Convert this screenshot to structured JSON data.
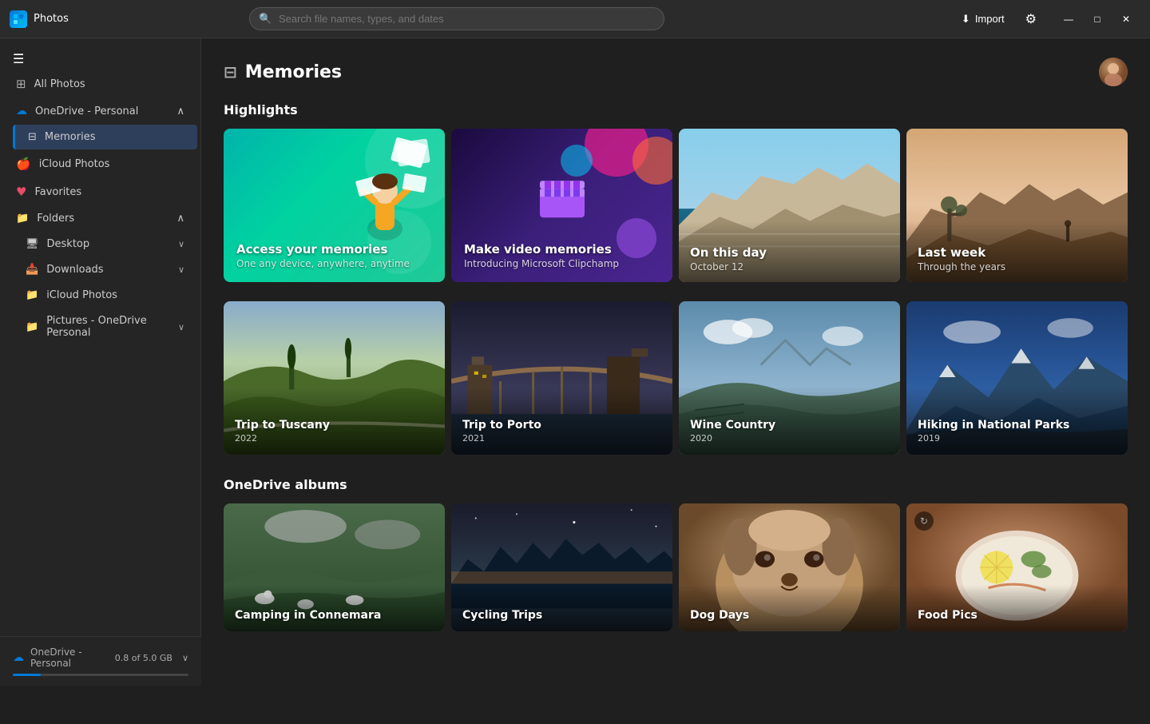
{
  "app": {
    "title": "Photos",
    "logo_icon": "🖼"
  },
  "titlebar": {
    "search_placeholder": "Search file names, types, and dates",
    "import_label": "Import",
    "import_icon": "⬇",
    "gear_icon": "⚙",
    "minimize": "—",
    "maximize": "□",
    "close": "✕"
  },
  "sidebar": {
    "hamburger_icon": "☰",
    "items": [
      {
        "id": "all-photos",
        "label": "All Photos",
        "icon": "🏠"
      },
      {
        "id": "onedrive-personal",
        "label": "OneDrive - Personal",
        "icon": "☁",
        "expandable": true,
        "expanded": true
      },
      {
        "id": "memories",
        "label": "Memories",
        "icon": "📋",
        "active": true,
        "subsection": true
      },
      {
        "id": "icloud-photos",
        "label": "iCloud Photos",
        "icon": "🍎"
      },
      {
        "id": "favorites",
        "label": "Favorites",
        "icon": "♥"
      },
      {
        "id": "folders",
        "label": "Folders",
        "icon": "📁",
        "expandable": true,
        "expanded": true
      },
      {
        "id": "desktop",
        "label": "Desktop",
        "icon": "🖥",
        "subsection": true,
        "expandable": true
      },
      {
        "id": "downloads",
        "label": "Downloads",
        "icon": "📥",
        "subsection": true,
        "expandable": true
      },
      {
        "id": "icloud-photos-folder",
        "label": "iCloud Photos",
        "icon": "📁",
        "subsection": true
      },
      {
        "id": "pictures",
        "label": "Pictures - OneDrive Personal",
        "icon": "📁",
        "subsection": true,
        "expandable": true
      }
    ],
    "footer": {
      "onedrive_label": "OneDrive - Personal",
      "storage": "0.8 of 5.0 GB",
      "chevron": "∨"
    }
  },
  "page": {
    "title": "Memories",
    "title_icon": "📋"
  },
  "highlights": {
    "section_title": "Highlights",
    "cards": [
      {
        "id": "access-memories",
        "title": "Access your memories",
        "subtitle": "One any device, anywhere, anytime",
        "type": "promo-green"
      },
      {
        "id": "make-video",
        "title": "Make video memories",
        "subtitle": "Introducing Microsoft Clipchamp",
        "type": "promo-purple"
      },
      {
        "id": "on-this-day",
        "title": "On this day",
        "subtitle": "October 12",
        "type": "photo-cliffs"
      },
      {
        "id": "last-week",
        "title": "Last week",
        "subtitle": "Through the years",
        "type": "photo-desert"
      }
    ]
  },
  "memories": {
    "cards": [
      {
        "id": "tuscany",
        "title": "Trip to Tuscany",
        "year": "2022",
        "type": "bg-tuscany"
      },
      {
        "id": "porto",
        "title": "Trip to Porto",
        "year": "2021",
        "type": "bg-porto"
      },
      {
        "id": "wine-country",
        "title": "Wine Country",
        "year": "2020",
        "type": "bg-wine"
      },
      {
        "id": "hiking",
        "title": "Hiking in National Parks",
        "year": "2019",
        "type": "bg-hiking"
      }
    ]
  },
  "onedrive_albums": {
    "section_title": "OneDrive albums",
    "cards": [
      {
        "id": "connemara",
        "title": "Camping in Connemara",
        "type": "bg-connemara"
      },
      {
        "id": "cycling",
        "title": "Cycling Trips",
        "type": "bg-cycling"
      },
      {
        "id": "dog-days",
        "title": "Dog Days",
        "type": "bg-dog"
      },
      {
        "id": "food-pics",
        "title": "Food Pics",
        "type": "bg-food"
      }
    ]
  }
}
